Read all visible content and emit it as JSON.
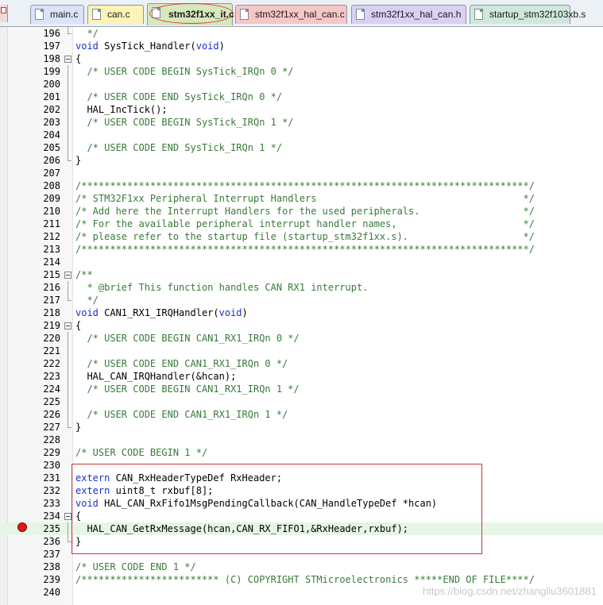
{
  "tabs": [
    {
      "label": "main.c",
      "color": "#dbe3fb",
      "active": false
    },
    {
      "label": "can.c",
      "color": "#fdf3b6",
      "active": false
    },
    {
      "label": "stm32f1xx_it.c",
      "color": "#d6e8bc",
      "active": true
    },
    {
      "label": "stm32f1xx_hal_can.c",
      "color": "#f7c6c6",
      "active": false
    },
    {
      "label": "stm32f1xx_hal_can.h",
      "color": "#d9d0f4",
      "active": false
    },
    {
      "label": "startup_stm32f103xb.s",
      "color": "#cfe8dc",
      "active": false
    }
  ],
  "editor": {
    "current_line": 235,
    "breakpoint_line": 235,
    "lines": [
      {
        "num": "196",
        "fold": "end",
        "parts": [
          {
            "t": "  */",
            "c": "comment"
          }
        ]
      },
      {
        "num": "197",
        "fold": "",
        "parts": [
          {
            "t": "void",
            "c": "keyword"
          },
          {
            "t": " SysTick_Handler(",
            "c": "plain"
          },
          {
            "t": "void",
            "c": "keyword"
          },
          {
            "t": ")",
            "c": "plain"
          }
        ]
      },
      {
        "num": "198",
        "fold": "box",
        "parts": [
          {
            "t": "{",
            "c": "plain"
          }
        ]
      },
      {
        "num": "199",
        "fold": "bar",
        "parts": [
          {
            "t": "  /* USER CODE BEGIN SysTick_IRQn 0 */",
            "c": "comment"
          }
        ]
      },
      {
        "num": "200",
        "fold": "bar",
        "parts": []
      },
      {
        "num": "201",
        "fold": "bar",
        "parts": [
          {
            "t": "  /* USER CODE END SysTick_IRQn 0 */",
            "c": "comment"
          }
        ]
      },
      {
        "num": "202",
        "fold": "bar",
        "parts": [
          {
            "t": "  HAL_IncTick();",
            "c": "plain"
          }
        ]
      },
      {
        "num": "203",
        "fold": "bar",
        "parts": [
          {
            "t": "  /* USER CODE BEGIN SysTick_IRQn 1 */",
            "c": "comment"
          }
        ]
      },
      {
        "num": "204",
        "fold": "bar",
        "parts": []
      },
      {
        "num": "205",
        "fold": "bar",
        "parts": [
          {
            "t": "  /* USER CODE END SysTick_IRQn 1 */",
            "c": "comment"
          }
        ]
      },
      {
        "num": "206",
        "fold": "end",
        "parts": [
          {
            "t": "}",
            "c": "plain"
          }
        ]
      },
      {
        "num": "207",
        "fold": "",
        "parts": []
      },
      {
        "num": "208",
        "fold": "",
        "parts": [
          {
            "t": "/******************************************************************************/",
            "c": "comment"
          }
        ]
      },
      {
        "num": "209",
        "fold": "",
        "parts": [
          {
            "t": "/* STM32F1xx Peripheral Interrupt Handlers                                    */",
            "c": "comment"
          }
        ]
      },
      {
        "num": "210",
        "fold": "",
        "parts": [
          {
            "t": "/* Add here the Interrupt Handlers for the used peripherals.                  */",
            "c": "comment"
          }
        ]
      },
      {
        "num": "211",
        "fold": "",
        "parts": [
          {
            "t": "/* For the available peripheral interrupt handler names,                      */",
            "c": "comment"
          }
        ]
      },
      {
        "num": "212",
        "fold": "",
        "parts": [
          {
            "t": "/* please refer to the startup file (startup_stm32f1xx.s).                    */",
            "c": "comment"
          }
        ]
      },
      {
        "num": "213",
        "fold": "",
        "parts": [
          {
            "t": "/******************************************************************************/",
            "c": "comment"
          }
        ]
      },
      {
        "num": "214",
        "fold": "",
        "parts": []
      },
      {
        "num": "215",
        "fold": "box",
        "parts": [
          {
            "t": "/**",
            "c": "comment"
          }
        ]
      },
      {
        "num": "216",
        "fold": "bar",
        "parts": [
          {
            "t": "  * @brief This function handles CAN RX1 interrupt.",
            "c": "comment"
          }
        ]
      },
      {
        "num": "217",
        "fold": "end",
        "parts": [
          {
            "t": "  */",
            "c": "comment"
          }
        ]
      },
      {
        "num": "218",
        "fold": "",
        "parts": [
          {
            "t": "void",
            "c": "keyword"
          },
          {
            "t": " CAN1_RX1_IRQHandler(",
            "c": "plain"
          },
          {
            "t": "void",
            "c": "keyword"
          },
          {
            "t": ")",
            "c": "plain"
          }
        ]
      },
      {
        "num": "219",
        "fold": "box",
        "parts": [
          {
            "t": "{",
            "c": "plain"
          }
        ]
      },
      {
        "num": "220",
        "fold": "bar",
        "parts": [
          {
            "t": "  /* USER CODE BEGIN CAN1_RX1_IRQn 0 */",
            "c": "comment"
          }
        ]
      },
      {
        "num": "221",
        "fold": "bar",
        "parts": []
      },
      {
        "num": "222",
        "fold": "bar",
        "parts": [
          {
            "t": "  /* USER CODE END CAN1_RX1_IRQn 0 */",
            "c": "comment"
          }
        ]
      },
      {
        "num": "223",
        "fold": "bar",
        "parts": [
          {
            "t": "  HAL_CAN_IRQHandler(&hcan);",
            "c": "plain"
          }
        ]
      },
      {
        "num": "224",
        "fold": "bar",
        "parts": [
          {
            "t": "  /* USER CODE BEGIN CAN1_RX1_IRQn 1 */",
            "c": "comment"
          }
        ]
      },
      {
        "num": "225",
        "fold": "bar",
        "parts": []
      },
      {
        "num": "226",
        "fold": "bar",
        "parts": [
          {
            "t": "  /* USER CODE END CAN1_RX1_IRQn 1 */",
            "c": "comment"
          }
        ]
      },
      {
        "num": "227",
        "fold": "end",
        "parts": [
          {
            "t": "}",
            "c": "plain"
          }
        ]
      },
      {
        "num": "228",
        "fold": "",
        "parts": []
      },
      {
        "num": "229",
        "fold": "",
        "parts": [
          {
            "t": "/* USER CODE BEGIN 1 */",
            "c": "comment"
          }
        ]
      },
      {
        "num": "230",
        "fold": "",
        "parts": []
      },
      {
        "num": "231",
        "fold": "",
        "parts": [
          {
            "t": "extern",
            "c": "keyword"
          },
          {
            "t": " CAN_RxHeaderTypeDef RxHeader;",
            "c": "plain"
          }
        ]
      },
      {
        "num": "232",
        "fold": "",
        "parts": [
          {
            "t": "extern",
            "c": "keyword"
          },
          {
            "t": " uint8_t rxbuf[8];",
            "c": "plain"
          }
        ]
      },
      {
        "num": "233",
        "fold": "",
        "parts": [
          {
            "t": "void",
            "c": "keyword"
          },
          {
            "t": " HAL_CAN_RxFifo1MsgPendingCallback(CAN_HandleTypeDef *hcan)",
            "c": "plain"
          }
        ]
      },
      {
        "num": "234",
        "fold": "box",
        "parts": [
          {
            "t": "{",
            "c": "plain"
          }
        ]
      },
      {
        "num": "235",
        "fold": "bar",
        "parts": [
          {
            "t": "  HAL_CAN_GetRxMessage(hcan,CAN_RX_FIFO1,&RxHeader,rxbuf);",
            "c": "plain"
          }
        ]
      },
      {
        "num": "236",
        "fold": "end",
        "parts": [
          {
            "t": "}",
            "c": "plain"
          }
        ]
      },
      {
        "num": "237",
        "fold": "",
        "parts": []
      },
      {
        "num": "238",
        "fold": "",
        "parts": [
          {
            "t": "/* USER CODE END 1 */",
            "c": "comment"
          }
        ]
      },
      {
        "num": "239",
        "fold": "",
        "parts": [
          {
            "t": "/************************ (C) COPYRIGHT STMicroelectronics *****END OF FILE****/",
            "c": "comment"
          }
        ]
      },
      {
        "num": "240",
        "fold": "",
        "parts": []
      }
    ]
  },
  "watermark": "https://blog.csdn.net/zhangliu3601881",
  "colors": {
    "comment": "#3a7a3a",
    "keyword": "#1a2fd0",
    "current_line": "#e6f6e6",
    "breakpoint": "#e01818",
    "highlight_box": "#d83030"
  }
}
